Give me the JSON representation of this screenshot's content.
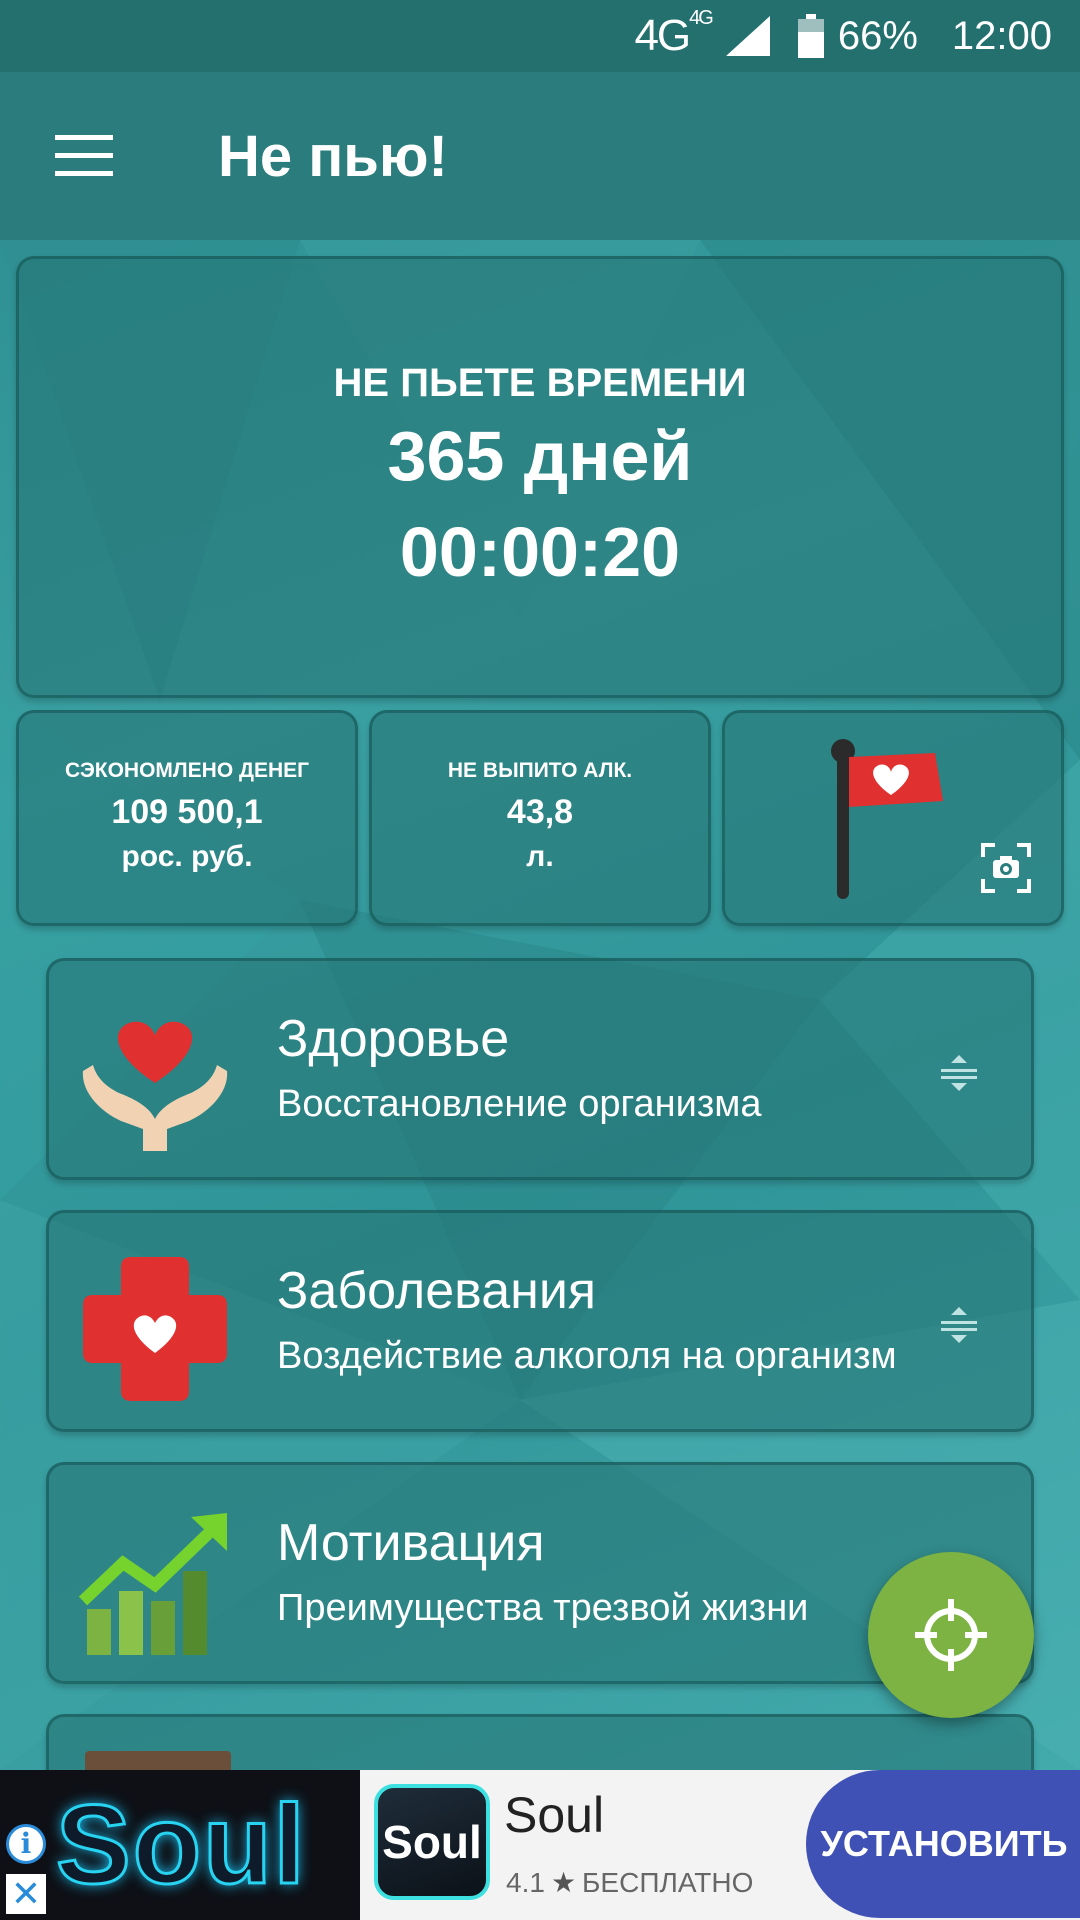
{
  "status_bar": {
    "network": "4G",
    "network_small": "4G",
    "battery": "66%",
    "time": "12:00"
  },
  "app_bar": {
    "title": "Не пью!",
    "menu_icon": "hamburger-menu-icon"
  },
  "timer": {
    "label": "НЕ ПЬЕТЕ ВРЕМЕНИ",
    "days": "365 дней",
    "clock": "00:00:20"
  },
  "stats": [
    {
      "label": "СЭКОНОМЛЕНО ДЕНЕГ",
      "value": "109 500,1",
      "unit": "рос. руб."
    },
    {
      "label": "НЕ ВЫПИТО АЛК.",
      "value": "43,8",
      "unit": "л."
    }
  ],
  "flag_card": {
    "icon": "heart-flag-icon",
    "action_icon": "camera-icon"
  },
  "list": [
    {
      "title": "Здоровье",
      "subtitle": "Восстановление организма",
      "icon": "heart-hands-icon"
    },
    {
      "title": "Заболевания",
      "subtitle": "Воздействие алкоголя на организм",
      "icon": "medical-cross-heart-icon"
    },
    {
      "title": "Мотивация",
      "subtitle": "Преимущества трезвой жизни",
      "icon": "growth-chart-icon"
    }
  ],
  "fab": {
    "icon": "crosshair-target-icon"
  },
  "ad": {
    "banner_text": "Soul",
    "app_icon_text": "Soul",
    "app_name": "Soul",
    "rating": "4.1",
    "price": "БЕСПЛАТНО",
    "install_label": "УСТАНОВИТЬ"
  },
  "colors": {
    "status_bar": "#23706f",
    "app_bar": "#2b7c7c",
    "fab": "#7cb342",
    "install_button": "#3f51b5",
    "heart_red": "#e03030"
  }
}
